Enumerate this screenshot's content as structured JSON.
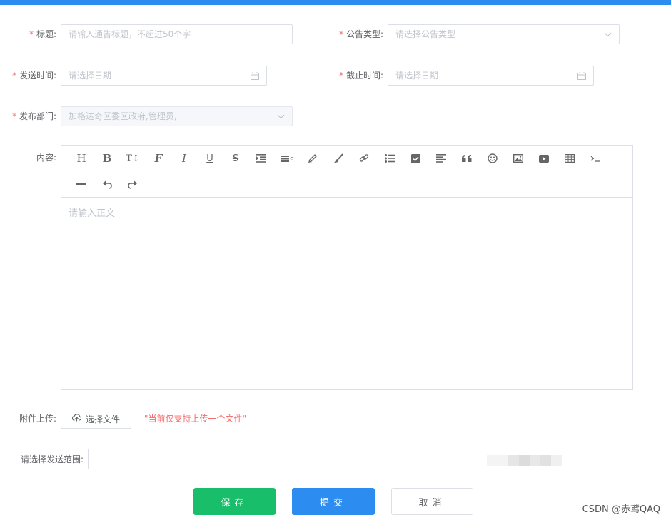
{
  "form": {
    "title": {
      "label": "标题:",
      "placeholder": "请输入通告标题，不超过50个字"
    },
    "notice_type": {
      "label": "公告类型:",
      "placeholder": "请选择公告类型"
    },
    "send_time": {
      "label": "发送时间:",
      "placeholder": "请选择日期"
    },
    "deadline": {
      "label": "截止时间:",
      "placeholder": "请选择日期"
    },
    "department": {
      "label": "发布部门:",
      "value": "加格达奇区委区政府,管理员,"
    },
    "content": {
      "label": "内容:",
      "placeholder": "请输入正文",
      "toolbar_icons": [
        "heading-icon",
        "bold-icon",
        "font-size-icon",
        "font-family-icon",
        "italic-icon",
        "underline-icon",
        "strikethrough-icon",
        "indent-icon",
        "line-height-icon",
        "font-color-icon",
        "background-color-icon",
        "link-icon",
        "bullet-list-icon",
        "todo-icon",
        "justify-icon",
        "quote-icon",
        "emoji-icon",
        "image-icon",
        "video-icon",
        "table-icon",
        "code-icon",
        "divider-icon",
        "undo-icon",
        "redo-icon"
      ],
      "toolbar_glyphs": {
        "heading": "H",
        "bold": "B",
        "font_size": "T↕",
        "font_family": "F",
        "italic": "I",
        "underline": "U",
        "strike": "S"
      }
    },
    "attachment": {
      "label": "附件上传:",
      "button": "选择文件",
      "hint": "\"当前仅支持上传一个文件\""
    },
    "scope": {
      "label": "请选择发送范围:",
      "value": ""
    }
  },
  "actions": {
    "save": "保存",
    "submit": "提交",
    "cancel": "取消"
  },
  "watermark": "CSDN @赤鸢QAQ",
  "required_mark": "*",
  "colors": {
    "primary": "#2d8cf0",
    "success": "#19be6b",
    "danger": "#f56c6c",
    "border": "#dcdfe6"
  }
}
